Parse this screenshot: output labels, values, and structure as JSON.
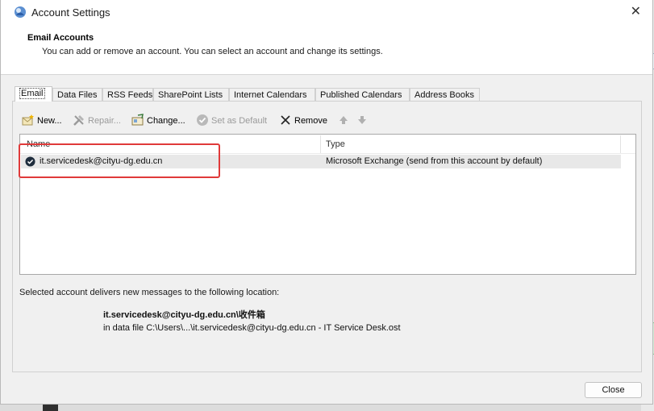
{
  "window": {
    "title": "Account Settings",
    "close_glyph": "✕"
  },
  "header": {
    "title": "Email Accounts",
    "description": "You can add or remove an account. You can select an account and change its settings."
  },
  "tabs": [
    {
      "label": "Email",
      "active": true
    },
    {
      "label": "Data Files"
    },
    {
      "label": "RSS Feeds"
    },
    {
      "label": "SharePoint Lists"
    },
    {
      "label": "Internet Calendars"
    },
    {
      "label": "Published Calendars"
    },
    {
      "label": "Address Books"
    }
  ],
  "toolbar": {
    "new_label": "New...",
    "repair_label": "Repair...",
    "change_label": "Change...",
    "set_default_label": "Set as Default",
    "remove_label": "Remove"
  },
  "accounts_table": {
    "columns": [
      "Name",
      "Type"
    ],
    "rows": [
      {
        "name": "it.servicedesk@cityu-dg.edu.cn",
        "type": "Microsoft Exchange (send from this account by default)"
      }
    ]
  },
  "delivery": {
    "label": "Selected account delivers new messages to the following location:",
    "path": "it.servicedesk@cityu-dg.edu.cn\\收件箱",
    "data_file": "in data file C:\\Users\\...\\it.servicedesk@cityu-dg.edu.cn - IT Service Desk.ost"
  },
  "footer": {
    "close_label": "Close"
  },
  "colors": {
    "highlight": "#e03a3a",
    "window_bg": "#f0f0f0"
  }
}
